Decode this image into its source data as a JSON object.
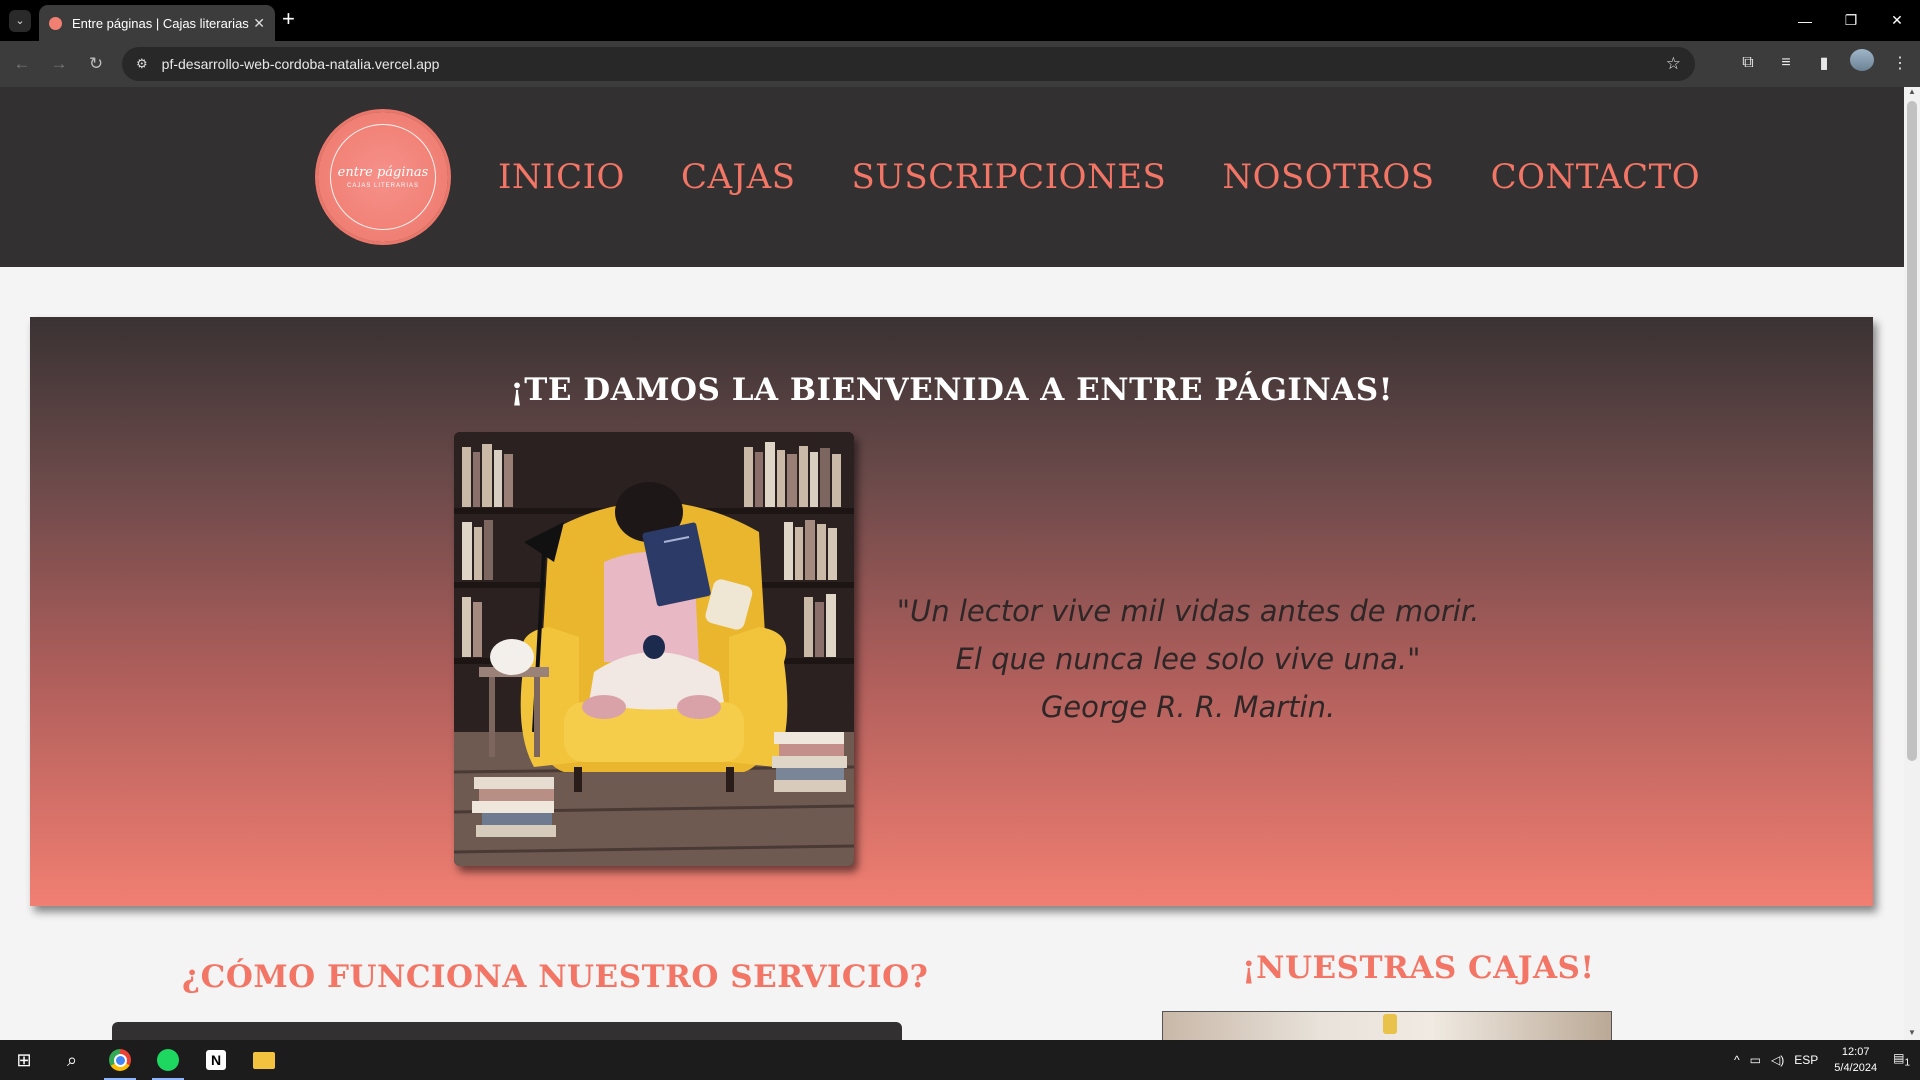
{
  "browser": {
    "tab_title": "Entre páginas | Cajas literarias",
    "url": "pf-desarrollo-web-cordoba-natalia.vercel.app"
  },
  "logo": {
    "name": "entre páginas",
    "subtitle": "CAJAS LITERARIAS"
  },
  "nav": {
    "items": [
      "INICIO",
      "CAJAS",
      "SUSCRIPCIONES",
      "NOSOTROS",
      "CONTACTO"
    ]
  },
  "hero": {
    "title": "¡TE DAMOS LA BIENVENIDA A ENTRE PÁGINAS!",
    "quote_line1": "\"Un lector vive mil vidas antes de morir.",
    "quote_line2": "El que nunca lee solo vive una.\"",
    "quote_author": "George R. R. Martin."
  },
  "sections": {
    "how_title": "¿CÓMO FUNCIONA NUESTRO SERVICIO?",
    "boxes_title": "¡NUESTRAS CAJAS!"
  },
  "taskbar": {
    "language": "ESP",
    "time": "12:07",
    "date": "5/4/2024",
    "notification_count": "1"
  },
  "colors": {
    "accent": "#f27565",
    "header_bg": "#323031"
  }
}
